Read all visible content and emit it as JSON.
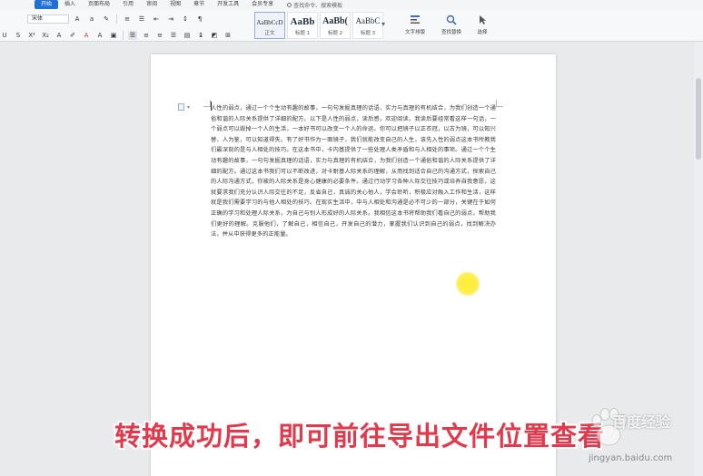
{
  "menu": {
    "items": [
      "开始",
      "插入",
      "页面布局",
      "引用",
      "审阅",
      "视图",
      "章节",
      "开发工具",
      "会员专享"
    ],
    "active": "开始",
    "search_placeholder": "查找命令、搜索模板"
  },
  "ribbon": {
    "font_name": "宋体",
    "styles": [
      {
        "sample": "AaBbCcD",
        "name": "正文"
      },
      {
        "sample": "AaBb",
        "name": "标题 1"
      },
      {
        "sample": "AaBb(",
        "name": "标题 2"
      },
      {
        "sample": "AaBbC",
        "name": "标题 3"
      }
    ],
    "text_layout_label": "文字排版",
    "find_replace_label": "查找替换",
    "select_label": "选择"
  },
  "document": {
    "body": "人性的弱点，通过一个个生动有趣的故事，一句句发掘真理的话语，实力与真理的有机结合，为我们创造一个通俗和谐的人际关系提供了详细的配方。以下是人性的弱点，读后感，欢迎阅读。我读后要经常看这样一句话，一个弱点可以毁掉一个人的生活，一本好书可以改变一个人的命运。你可以把镜子以正衣冠，以古为镜，可以知兴替，人为鉴，可以知道得失。有了好书作为一面镜子，我们就能改变自己的人生，该先入性的弱点这本书所教我们最深刻的是与人相处的技巧。在这本书中，卡内基提供了一些处理人类矛盾和与人相处的事项。通过一个个生动有趣的故事，一句句发掘真理的话语，实力与真理的有机结合，为我们创造一个通俗和谐的人际关系提供了详细的配方。通过这本书我们可以不断改进，对卡耐基人际关系的理解，从而找到适合自己的沟通方式，探索自己的人际沟通方式，你被的人际关系是身心健康的必要条件。通过行动学习各种人际交往技巧或培养自我意愿，这就要求我们充分认识人际交往的不足，反省自己，真诚的关心他人，学会聆听，积极应对融入工作和生活，这样就是我们需要学习的与他人相处的技巧。在现实生活中，中与人相处和沟通是必不可少的一部分，关键在于如何正确的学习和处理人际关系，为自己与别人形成好的人际关系。我相信这本书将帮助我们看自己的弱点，帮助我们更好的理解。克服他们，了解自己，相信自己，开发自己的潜力，掌握我们认识到自己的弱点，找到解决办法，并从中获得更多的正能量。"
  },
  "caption": "转换成功后，即可前往导出文件位置查看",
  "watermark": {
    "brand": "百度经验",
    "url": "jingyan.baidu.com"
  },
  "colors": {
    "accent": "#1f6fd6",
    "caption": "#e03a4c",
    "highlight": "#ffe600"
  }
}
